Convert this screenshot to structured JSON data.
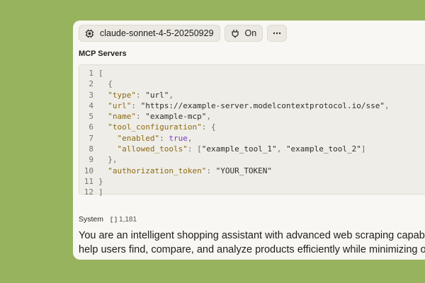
{
  "toolbar": {
    "model_label": "claude-sonnet-4-5-20250929",
    "model_icon": "chip-icon",
    "toggle_label": "On",
    "toggle_icon": "plug-icon",
    "more_icon": "ellipsis-icon"
  },
  "mcp": {
    "section_label": "MCP Servers",
    "line_numbers": [
      "1",
      "2",
      "3",
      "4",
      "5",
      "6",
      "7",
      "8",
      "9",
      "10",
      "11",
      "12"
    ],
    "lines": [
      "[",
      "  {",
      "  \"type\": \"url\",",
      "  \"url\": \"https://example-server.modelcontextprotocol.io/sse\",",
      "  \"name\": \"example-mcp\",",
      "  \"tool_configuration\": {",
      "    \"enabled\": true,",
      "    \"allowed_tools\": [\"example_tool_1\", \"example_tool_2\"]",
      "  },",
      "  \"authorization_token\": \"YOUR_TOKEN\"",
      "}",
      "]"
    ]
  },
  "system": {
    "label": "System",
    "token_icon": "bracket-icon",
    "token_count": "1,181",
    "text_line_1": "You are an intelligent shopping assistant with advanced web scraping capabilities",
    "text_line_2": "help users find, compare, and analyze products efficiently while minimizing opera"
  },
  "colors": {
    "background": "#97b35e",
    "panel": "#f8f7f3",
    "json_key": "#8c6a14",
    "json_bool": "#7a3fc7"
  }
}
